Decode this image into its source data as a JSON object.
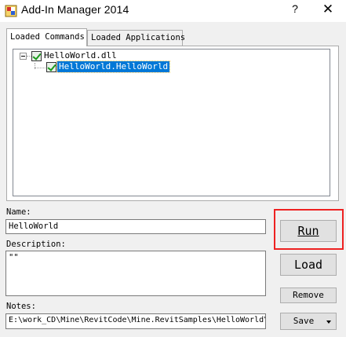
{
  "window": {
    "title": "Add-In Manager 2014",
    "help_label": "?",
    "close_label": "✕",
    "app_icon": "addin-manager-icon"
  },
  "tabs": [
    {
      "label": "Loaded Commands",
      "active": true
    },
    {
      "label": "Loaded Applications",
      "active": false
    }
  ],
  "tree": {
    "root": {
      "label": "HelloWorld.dll",
      "checked": true,
      "expanded": true
    },
    "children": [
      {
        "label": "HelloWorld.HelloWorld",
        "checked": true,
        "selected": true
      }
    ]
  },
  "form": {
    "name_label": "Name:",
    "name_value": "HelloWorld",
    "description_label": "Description:",
    "description_value": "\"\"",
    "notes_label": "Notes:",
    "notes_value": "E:\\work_CD\\Mine\\RevitCode\\Mine.RevitSamples\\HelloWorld\\"
  },
  "buttons": {
    "run": "Run",
    "load": "Load",
    "remove": "Remove",
    "save": "Save"
  },
  "colors": {
    "highlight_border": "#ee2222",
    "selection": "#0078d7",
    "check": "#1a9a1a"
  }
}
